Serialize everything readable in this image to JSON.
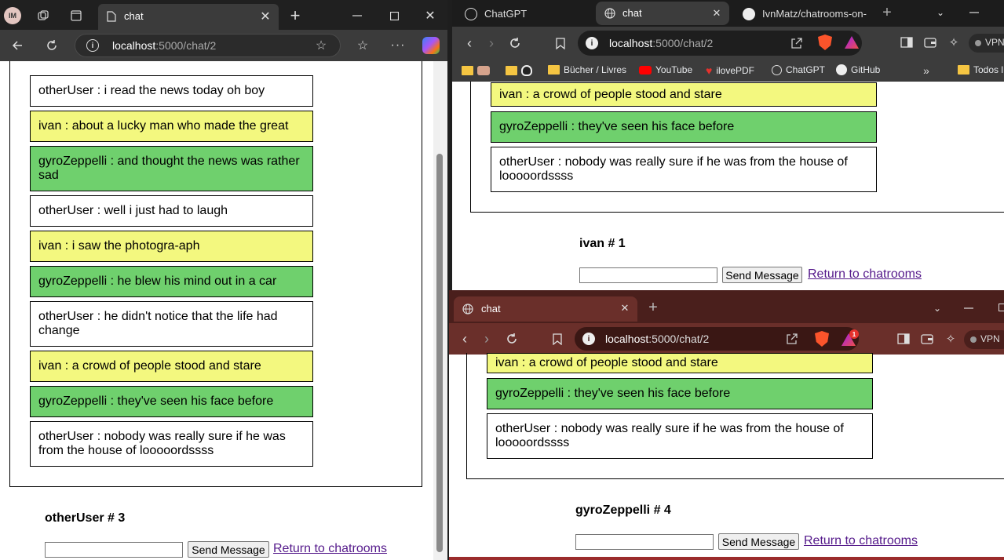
{
  "left": {
    "profile": "IM",
    "tab_title": "chat",
    "url_host": "localhost",
    "url_path": ":5000/chat/2",
    "messages": [
      {
        "text": "otherUser : i read the news today oh boy",
        "color": "white"
      },
      {
        "text": "ivan : about a lucky man who made the great",
        "color": "yellow"
      },
      {
        "text": "gyroZeppelli : and thought the news was rather sad",
        "color": "green"
      },
      {
        "text": "otherUser : well i just had to laugh",
        "color": "white"
      },
      {
        "text": "ivan : i saw the photogra-aph",
        "color": "yellow"
      },
      {
        "text": "gyroZeppelli : he blew his mind out in a car",
        "color": "green"
      },
      {
        "text": "otherUser : he didn't notice that the life had change",
        "color": "white"
      },
      {
        "text": "ivan : a crowd of people stood and stare",
        "color": "yellow"
      },
      {
        "text": "gyroZeppelli : they've seen his face before",
        "color": "green"
      },
      {
        "text": "otherUser : nobody was really sure if he was from the house of looooordssss",
        "color": "white"
      }
    ],
    "user_label": "otherUser # 3",
    "send_label": "Send Message",
    "return_label": "Return to chatrooms"
  },
  "brave_top": {
    "tabs": [
      "ChatGPT",
      "chat",
      "IvnMatz/chatrooms-on-"
    ],
    "url_host": "localhost",
    "url_path": ":5000/chat/2",
    "vpn": "VPN",
    "bookmarks": [
      "Bücher / Livres",
      "YouTube",
      "ilovePDF",
      "ChatGPT",
      "GitHub",
      "Todos l"
    ],
    "messages": [
      {
        "text": "ivan : a crowd of people stood and stare",
        "color": "yellow"
      },
      {
        "text": "gyroZeppelli : they've seen his face before",
        "color": "green"
      },
      {
        "text": "otherUser : nobody was really sure if he was from the house of looooordssss",
        "color": "white"
      }
    ],
    "user_label": "ivan # 1",
    "send_label": "Send Message",
    "return_label": "Return to chatrooms"
  },
  "brave_bottom": {
    "tab_title": "chat",
    "url_host": "localhost",
    "url_path": ":5000/chat/2",
    "vpn": "VPN",
    "badge": "1",
    "messages": [
      {
        "text": "ivan : a crowd of people stood and stare",
        "color": "yellow"
      },
      {
        "text": "gyroZeppelli : they've seen his face before",
        "color": "green"
      },
      {
        "text": "otherUser : nobody was really sure if he was from the house of looooordssss",
        "color": "white"
      }
    ],
    "user_label": "gyroZeppelli # 4",
    "send_label": "Send Message",
    "return_label": "Return to chatrooms"
  }
}
